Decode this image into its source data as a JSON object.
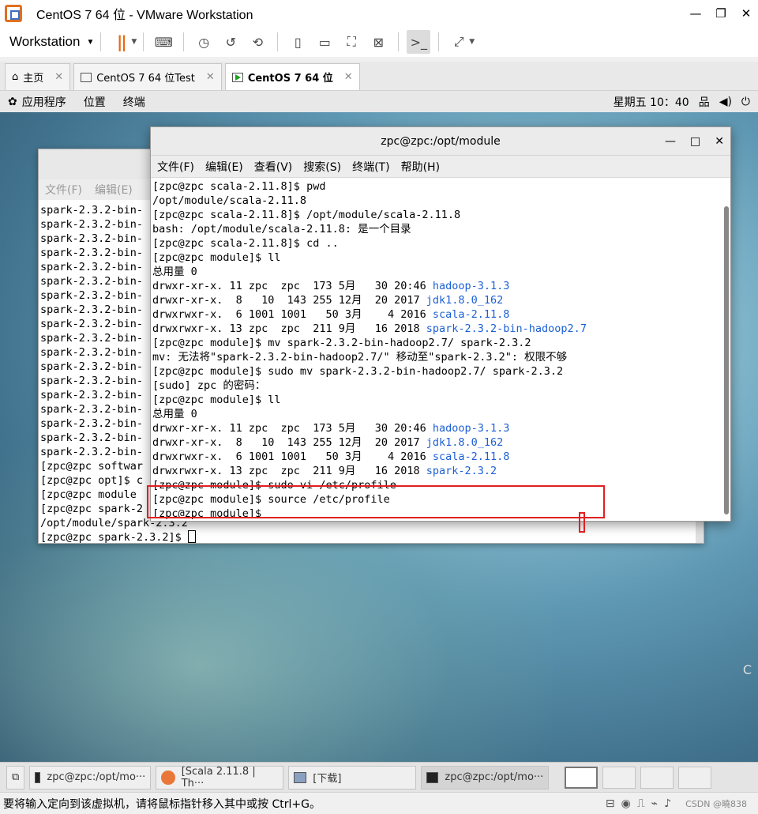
{
  "window": {
    "title": "CentOS 7 64 位 - VMware Workstation",
    "minimize": "—",
    "maximize": "❐",
    "close": "✕"
  },
  "toolbar": {
    "workstation_label": "Workstation"
  },
  "tabs": [
    {
      "label": "主页"
    },
    {
      "label": "CentOS 7 64 位Test"
    },
    {
      "label": "CentOS 7 64 位"
    }
  ],
  "gnome": {
    "apps_label": "应用程序",
    "places_label": "位置",
    "terminal_label": "终端",
    "clock": "星期五 10：40"
  },
  "back_terminal": {
    "menus": [
      "文件(F)",
      "编辑(E)"
    ],
    "lines": [
      "spark-2.3.2-bin-",
      "spark-2.3.2-bin-",
      "spark-2.3.2-bin-",
      "spark-2.3.2-bin-",
      "spark-2.3.2-bin-",
      "spark-2.3.2-bin-",
      "spark-2.3.2-bin-",
      "spark-2.3.2-bin-",
      "spark-2.3.2-bin-",
      "spark-2.3.2-bin-",
      "spark-2.3.2-bin-",
      "spark-2.3.2-bin-",
      "spark-2.3.2-bin-",
      "spark-2.3.2-bin-",
      "spark-2.3.2-bin-",
      "spark-2.3.2-bin-",
      "spark-2.3.2-bin-",
      "spark-2.3.2-bin-",
      "[zpc@zpc softwar",
      "[zpc@zpc opt]$ c",
      "[zpc@zpc module",
      "[zpc@zpc spark-2",
      "/opt/module/spark-2.3.2"
    ],
    "prompt": "[zpc@zpc spark-2.3.2]$ "
  },
  "front_terminal": {
    "title": "zpc@zpc:/opt/module",
    "menus": [
      "文件(F)",
      "编辑(E)",
      "查看(V)",
      "搜索(S)",
      "终端(T)",
      "帮助(H)"
    ],
    "lines": [
      {
        "text": "[zpc@zpc scala-2.11.8]$ pwd"
      },
      {
        "text": "/opt/module/scala-2.11.8"
      },
      {
        "text": "[zpc@zpc scala-2.11.8]$ /opt/module/scala-2.11.8"
      },
      {
        "text": "bash: /opt/module/scala-2.11.8: 是一个目录"
      },
      {
        "text": "[zpc@zpc scala-2.11.8]$ cd .."
      },
      {
        "text": "[zpc@zpc module]$ ll"
      },
      {
        "text": "总用量 0"
      },
      {
        "text": "drwxr-xr-x. 11 zpc  zpc  173 5月   30 20:46 ",
        "link": "hadoop-3.1.3"
      },
      {
        "text": "drwxr-xr-x.  8   10  143 255 12月  20 2017 ",
        "link": "jdk1.8.0_162"
      },
      {
        "text": "drwxrwxr-x.  6 1001 1001   50 3月    4 2016 ",
        "link": "scala-2.11.8"
      },
      {
        "text": "drwxrwxr-x. 13 zpc  zpc  211 9月   16 2018 ",
        "link": "spark-2.3.2-bin-hadoop2.7"
      },
      {
        "text": "[zpc@zpc module]$ mv spark-2.3.2-bin-hadoop2.7/ spark-2.3.2"
      },
      {
        "text": "mv: 无法将\"spark-2.3.2-bin-hadoop2.7/\" 移动至\"spark-2.3.2\": 权限不够"
      },
      {
        "text": "[zpc@zpc module]$ sudo mv spark-2.3.2-bin-hadoop2.7/ spark-2.3.2"
      },
      {
        "text": "[sudo] zpc 的密码："
      },
      {
        "text": "[zpc@zpc module]$ ll"
      },
      {
        "text": "总用量 0"
      },
      {
        "text": "drwxr-xr-x. 11 zpc  zpc  173 5月   30 20:46 ",
        "link": "hadoop-3.1.3"
      },
      {
        "text": "drwxr-xr-x.  8   10  143 255 12月  20 2017 ",
        "link": "jdk1.8.0_162"
      },
      {
        "text": "drwxrwxr-x.  6 1001 1001   50 3月    4 2016 ",
        "link": "scala-2.11.8"
      },
      {
        "text": "drwxrwxr-x. 13 zpc  zpc  211 9月   16 2018 ",
        "link": "spark-2.3.2"
      },
      {
        "text": "[zpc@zpc module]$ sudo vi /etc/profile"
      },
      {
        "text": "[zpc@zpc module]$ source /etc/profile"
      },
      {
        "text": "[zpc@zpc module]$ "
      }
    ]
  },
  "taskbar": {
    "items": [
      {
        "label": "zpc@zpc:/opt/mo···"
      },
      {
        "label": "[Scala 2.11.8 | Th···"
      },
      {
        "label": "[下载]"
      },
      {
        "label": "zpc@zpc:/opt/mo···"
      }
    ]
  },
  "status": {
    "message": "要将输入定向到该虚拟机，请将鼠标指针移入其中或按 Ctrl+G。",
    "watermark": "CSDN @曉838"
  },
  "desktop": {
    "edge_glyph": "C"
  }
}
